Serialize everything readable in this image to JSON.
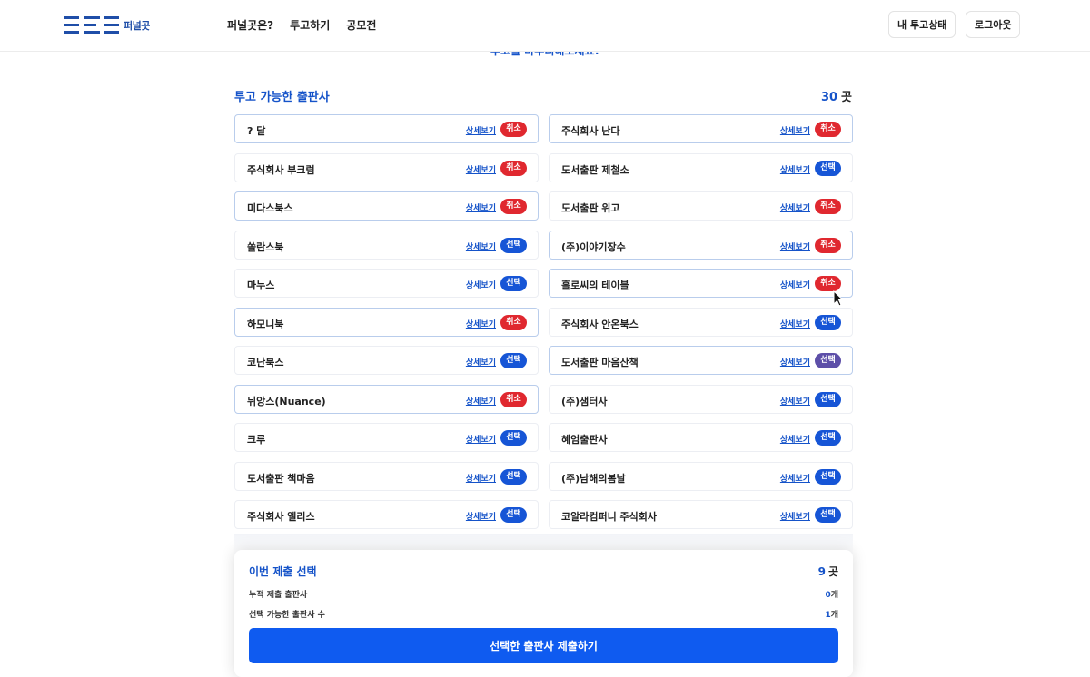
{
  "header": {
    "logo_text": "퍼널곳",
    "nav": [
      "퍼널곳은?",
      "투고하기",
      "공모전"
    ],
    "status_button": "내 투고상태",
    "logout_button": "로그아웃"
  },
  "banner_text": "투고를 마무리해보세요!",
  "publishers": {
    "title": "투고 가능한 출판사",
    "count": "30",
    "count_unit": "곳",
    "detail_label": "상세보기",
    "left": [
      {
        "name": "? 달",
        "badge": "취소",
        "status": "cancel"
      },
      {
        "name": "주식회사 부크럼",
        "badge": "취소",
        "status": "cancel"
      },
      {
        "name": "미다스북스",
        "badge": "취소",
        "status": "cancel"
      },
      {
        "name": "쏠란스북",
        "badge": "선택",
        "status": "select"
      },
      {
        "name": "마누스",
        "badge": "선택",
        "status": "select"
      },
      {
        "name": "하모니북",
        "badge": "취소",
        "status": "cancel"
      },
      {
        "name": "코난북스",
        "badge": "선택",
        "status": "select"
      },
      {
        "name": "뉘앙스(Nuance)",
        "badge": "취소",
        "status": "cancel"
      },
      {
        "name": "크루",
        "badge": "선택",
        "status": "select"
      },
      {
        "name": "도서출판 책마음",
        "badge": "선택",
        "status": "select"
      },
      {
        "name": "주식회사 엘리스",
        "badge": "선택",
        "status": "select"
      }
    ],
    "right": [
      {
        "name": "주식회사 난다",
        "badge": "취소",
        "status": "cancel"
      },
      {
        "name": "도서출판 제철소",
        "badge": "선택",
        "status": "select"
      },
      {
        "name": "도서출판 위고",
        "badge": "취소",
        "status": "cancel"
      },
      {
        "name": "(주)이야기장수",
        "badge": "취소",
        "status": "cancel"
      },
      {
        "name": "홀로씨의 테이블",
        "badge": "취소",
        "status": "cancel"
      },
      {
        "name": "주식회사 안온북스",
        "badge": "선택",
        "status": "select"
      },
      {
        "name": "도서출판 마음산책",
        "badge": "선택",
        "status": "purple"
      },
      {
        "name": "(주)샘터사",
        "badge": "선택",
        "status": "select"
      },
      {
        "name": "혜엄출판사",
        "badge": "선택",
        "status": "select"
      },
      {
        "name": "(주)남해의봄날",
        "badge": "선택",
        "status": "select"
      },
      {
        "name": "코알라컴퍼니 주식회사",
        "badge": "선택",
        "status": "select"
      }
    ]
  },
  "submission": {
    "title": "이번 제출 선택",
    "count": "9",
    "count_unit": "곳",
    "rows": [
      {
        "label": "누적 제출 출판사",
        "value": "0",
        "unit": "개"
      },
      {
        "label": "선택 가능한 출판사 수",
        "value": "1",
        "unit": "개"
      }
    ],
    "submit_label": "선택한 출판사 제출하기"
  },
  "colors": {
    "accent": "#1553c9",
    "cancel": "#e0282f",
    "select": "#1655d6",
    "submit": "#0f5bf0"
  }
}
